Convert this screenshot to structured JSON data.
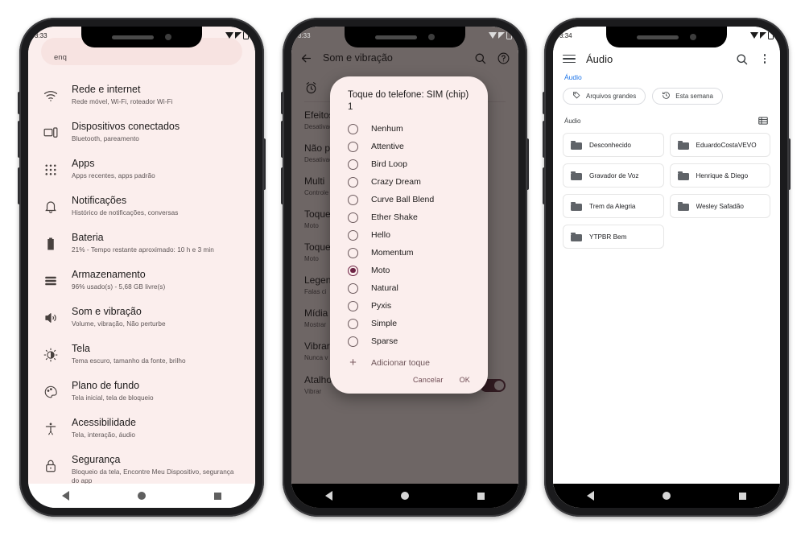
{
  "phone1": {
    "status": {
      "time": "3:33",
      "battery_label": "21"
    },
    "search_placeholder_visible": "enq",
    "settings": [
      {
        "icon": "wifi-icon",
        "title": "Rede e internet",
        "subtitle": "Rede móvel, Wi-Fi, roteador Wi-Fi"
      },
      {
        "icon": "devices-icon",
        "title": "Dispositivos conectados",
        "subtitle": "Bluetooth, pareamento"
      },
      {
        "icon": "apps-grid-icon",
        "title": "Apps",
        "subtitle": "Apps recentes, apps padrão"
      },
      {
        "icon": "bell-icon",
        "title": "Notificações",
        "subtitle": "Histórico de notificações, conversas"
      },
      {
        "icon": "battery-icon",
        "title": "Bateria",
        "subtitle": "21% - Tempo restante aproximado: 10 h e 3 min"
      },
      {
        "icon": "storage-icon",
        "title": "Armazenamento",
        "subtitle": "96% usado(s) - 5,68 GB livre(s)"
      },
      {
        "icon": "volume-icon",
        "title": "Som e vibração",
        "subtitle": "Volume, vibração, Não perturbe"
      },
      {
        "icon": "brightness-icon",
        "title": "Tela",
        "subtitle": "Tema escuro, tamanho da fonte, brilho"
      },
      {
        "icon": "palette-icon",
        "title": "Plano de fundo",
        "subtitle": "Tela inicial, tela de bloqueio"
      },
      {
        "icon": "accessibility-icon",
        "title": "Acessibilidade",
        "subtitle": "Tela, interação, áudio"
      },
      {
        "icon": "lock-icon",
        "title": "Segurança",
        "subtitle": "Bloqueio da tela, Encontre Meu Dispositivo, segurança do app"
      }
    ]
  },
  "phone2": {
    "status": {
      "time": "3:33",
      "battery_label": "21"
    },
    "appbar": {
      "title": "Som e vibração",
      "back_icon": "back-arrow-icon",
      "search_icon": "search-icon",
      "help_icon": "help-circle-icon"
    },
    "background_items": [
      {
        "title": "Efeitos",
        "subtitle": "Desativado"
      },
      {
        "title": "Não perturbe",
        "subtitle": "Desativado"
      },
      {
        "title": "Multi",
        "subtitle": "Controle ... uma só vez"
      },
      {
        "title": "Toque",
        "subtitle": "Moto"
      },
      {
        "title": "Toque",
        "subtitle": "Moto"
      },
      {
        "title": "Legendas",
        "subtitle": "Falas ci"
      },
      {
        "title": "Mídia",
        "subtitle": "Mostrar"
      },
      {
        "title": "Vibrar",
        "subtitle": "Nunca v"
      }
    ],
    "toggle_row": {
      "title": "Atalho para silenciar toque",
      "subtitle": "Vibrar",
      "state": "on"
    },
    "dialog": {
      "title": "Toque do telefone: SIM (chip) 1",
      "options": [
        {
          "label": "Nenhum",
          "selected": false
        },
        {
          "label": "Attentive",
          "selected": false
        },
        {
          "label": "Bird Loop",
          "selected": false
        },
        {
          "label": "Crazy Dream",
          "selected": false
        },
        {
          "label": "Curve Ball Blend",
          "selected": false
        },
        {
          "label": "Ether Shake",
          "selected": false
        },
        {
          "label": "Hello",
          "selected": false
        },
        {
          "label": "Momentum",
          "selected": false
        },
        {
          "label": "Moto",
          "selected": true
        },
        {
          "label": "Natural",
          "selected": false
        },
        {
          "label": "Pyxis",
          "selected": false
        },
        {
          "label": "Simple",
          "selected": false
        },
        {
          "label": "Sparse",
          "selected": false
        }
      ],
      "add_label": "Adicionar toque",
      "cancel_label": "Cancelar",
      "ok_label": "OK"
    }
  },
  "phone3": {
    "status": {
      "time": "3:34",
      "battery_label": "21"
    },
    "appbar": {
      "title": "Áudio",
      "menu_icon": "hamburger-icon",
      "search_icon": "search-icon",
      "more_icon": "kebab-menu-icon"
    },
    "breadcrumb": "Áudio",
    "chips": [
      {
        "label": "Arquivos grandes",
        "icon": "tag-icon"
      },
      {
        "label": "Esta semana",
        "icon": "history-clock-icon"
      }
    ],
    "section_label": "Áudio",
    "view_toggle_icon": "list-view-icon",
    "folders": [
      "Desconhecido",
      "EduardoCostaVEVO",
      "Gravador de Voz",
      "Henrique & Diego",
      "Trem da Alegria",
      "Wesley Safadão",
      "YTPBR Bem"
    ]
  },
  "colors": {
    "settings_bg": "#fbeeed",
    "accent_maroon": "#6d2344",
    "link_blue": "#1a73e8",
    "folder_gray": "#5f6368"
  }
}
